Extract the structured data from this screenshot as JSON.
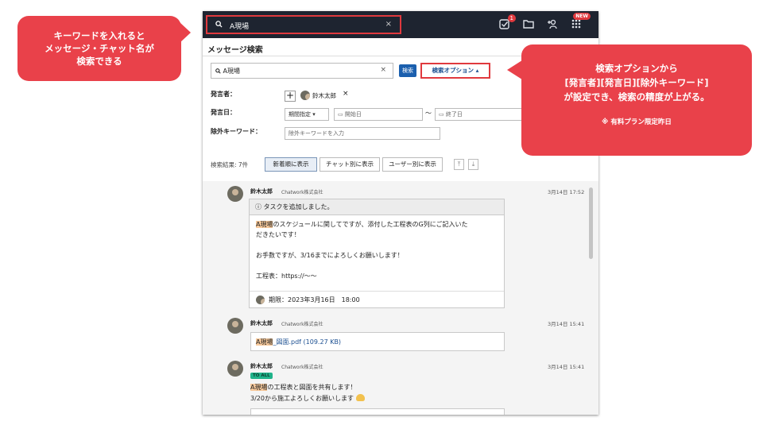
{
  "annotations": {
    "left": {
      "lines": [
        "キーワードを入れると",
        "メッセージ・チャット名が",
        "検索できる"
      ]
    },
    "right": {
      "lines": [
        "検索オプションから",
        "[発言者][発言日][除外キーワード]",
        "が設定でき、検索の精度が上がる。"
      ],
      "note": "※ 有料プラン限定昨日"
    }
  },
  "topbar": {
    "search_icon": "search-icon",
    "search_value": "A現場",
    "clear": "×",
    "task_badge": "1",
    "new_badge": "NEW"
  },
  "page": {
    "title": "メッセージ検索"
  },
  "search": {
    "value": "A現場",
    "clear": "×",
    "search_button": "検索",
    "options_button": "検索オプション ▴"
  },
  "filters": {
    "speaker_label": "発言者：",
    "speaker_name": "鈴木太郎",
    "speaker_remove": "×",
    "date_label": "発言日：",
    "period_select": "期間指定 ▾",
    "start_placeholder": "開始日",
    "tilde": "〜",
    "end_placeholder": "終了日",
    "exclude_label": "除外キーワード：",
    "exclude_placeholder": "除外キーワードを入力"
  },
  "results": {
    "count_label": "検索結果: 7件",
    "tabs": [
      "新着順に表示",
      "チャット別に表示",
      "ユーザー別に表示"
    ]
  },
  "messages": [
    {
      "name": "鈴木太郎",
      "company": "Chatwork株式会社",
      "date": "3月14日 17:52",
      "task_header": "ⓘ タスクを追加しました。",
      "highlight": "A現場",
      "line1_rest": "のスケジュールに関してですが、添付した工程表のG列にご記入いた",
      "line2": "だきたいです！",
      "line3": "お手数ですが、3/16までによろしくお願いします！",
      "line4": "工程表：https://〜〜",
      "deadline": "期限：2023年3月16日　18:00"
    },
    {
      "name": "鈴木太郎",
      "company": "Chatwork株式会社",
      "date": "3月14日 15:41",
      "highlight": "A現場",
      "file_rest": "_図面.pdf (109.27 KB)"
    },
    {
      "name": "鈴木太郎",
      "company": "Chatwork株式会社",
      "date": "3月14日 15:41",
      "to_all": "TO ALL",
      "highlight": "A現場",
      "line1_rest": "の工程表と図面を共有します！",
      "line2": "3/20から施工よろしくお願いします"
    }
  ],
  "colors": {
    "annotation": "#e9414a",
    "topbar": "#1e2430",
    "highlight_border": "#e0393e",
    "search_button": "#1b5fae",
    "keyword_highlight": "#f7c99b"
  }
}
